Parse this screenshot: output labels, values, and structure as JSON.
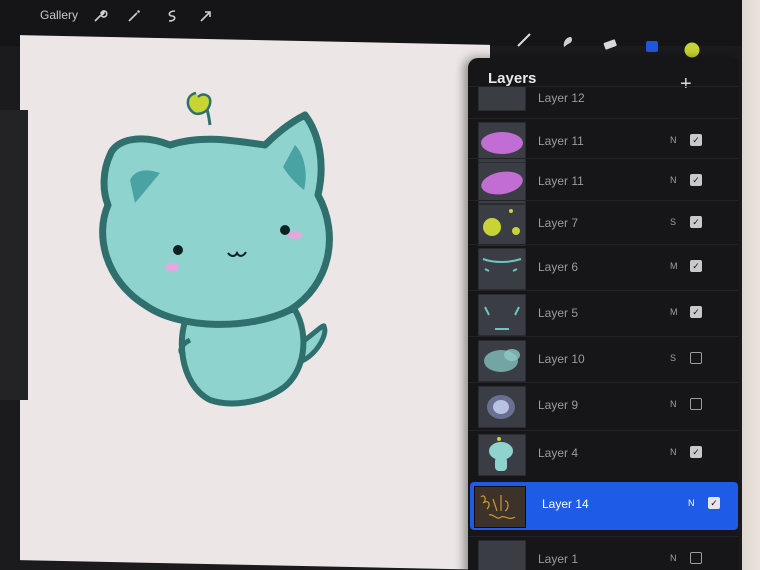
{
  "topbar": {
    "gallery_label": "Gallery",
    "left_icons": [
      "wrench-icon",
      "magic-wand-icon",
      "selection-icon",
      "transform-arrow-icon"
    ],
    "right_icons": [
      "brush-icon",
      "smudge-icon",
      "eraser-icon",
      "layers-icon",
      "color-swatch-icon"
    ],
    "current_color": "#c7d433"
  },
  "layers_panel": {
    "title": "Layers",
    "add_label": "+",
    "layers": [
      {
        "name": "Layer 12",
        "blend": "",
        "visible": true,
        "thumb": "empty"
      },
      {
        "name": "Layer 11",
        "blend": "N",
        "visible": true,
        "thumb": "purple-oval"
      },
      {
        "name": "Layer 11",
        "blend": "N",
        "visible": true,
        "thumb": "purple-oval"
      },
      {
        "name": "Layer 7",
        "blend": "S",
        "visible": true,
        "thumb": "yellow-dots"
      },
      {
        "name": "Layer 6",
        "blend": "M",
        "visible": true,
        "thumb": "teal-lines"
      },
      {
        "name": "Layer 5",
        "blend": "M",
        "visible": true,
        "thumb": "teal-marks"
      },
      {
        "name": "Layer 10",
        "blend": "S",
        "visible": false,
        "thumb": "teal-cloud"
      },
      {
        "name": "Layer 9",
        "blend": "N",
        "visible": false,
        "thumb": "cat-sketch"
      },
      {
        "name": "Layer 4",
        "blend": "N",
        "visible": true,
        "thumb": "cat-figure"
      },
      {
        "name": "Layer 14",
        "blend": "N",
        "visible": true,
        "thumb": "signature",
        "active": true
      },
      {
        "name": "Layer 1",
        "blend": "N",
        "visible": false,
        "thumb": "empty"
      }
    ]
  },
  "colors": {
    "accent": "#1e5be6",
    "canvas": "#ece7e6",
    "cat_fill": "#8fd3cf",
    "cat_outline": "#2f6f6d",
    "sprout": "#c7d433",
    "blush": "#e7a7de"
  }
}
